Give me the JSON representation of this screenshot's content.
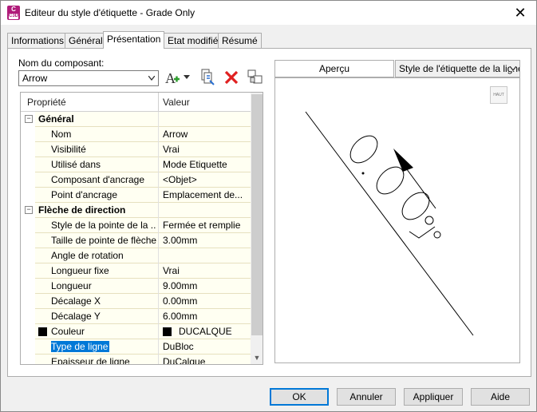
{
  "window": {
    "title": "Editeur du style d'étiquette - Grade Only",
    "icon_text": "C",
    "icon_sub": "C3D"
  },
  "tabs": [
    {
      "label": "Informations"
    },
    {
      "label": "Général"
    },
    {
      "label": "Présentation"
    },
    {
      "label": "Etat modifié"
    },
    {
      "label": "Résumé"
    }
  ],
  "active_tab": "Présentation",
  "component": {
    "label": "Nom du composant:",
    "value": "Arrow"
  },
  "grid": {
    "col_property": "Propriété",
    "col_value": "Valeur",
    "rows": [
      {
        "type": "category",
        "prop": "Général",
        "expander": "−"
      },
      {
        "prop": "Nom",
        "val": "Arrow"
      },
      {
        "prop": "Visibilité",
        "val": "Vrai"
      },
      {
        "prop": "Utilisé dans",
        "val": "Mode Etiquette"
      },
      {
        "prop": "Composant d'ancrage",
        "val": "<Objet>"
      },
      {
        "prop": "Point d'ancrage",
        "val": "Emplacement de..."
      },
      {
        "type": "category",
        "prop": "Flèche de direction",
        "expander": "−"
      },
      {
        "prop": "Style de la pointe de la ...",
        "val": "Fermée et remplie"
      },
      {
        "prop": "Taille de pointe de flèche",
        "val": "3.00mm"
      },
      {
        "prop": "Angle de rotation",
        "val": ""
      },
      {
        "prop": "Longueur fixe",
        "val": "Vrai"
      },
      {
        "prop": "Longueur",
        "val": "9.00mm"
      },
      {
        "prop": "Décalage X",
        "val": "0.00mm"
      },
      {
        "prop": "Décalage Y",
        "val": "6.00mm"
      },
      {
        "prop": "Couleur",
        "val": "DUCALQUE",
        "swatch": "#000000"
      },
      {
        "prop": "Type de ligne",
        "val": "DuBloc",
        "selected": true
      },
      {
        "prop": "Epaisseur de ligne",
        "val": "DuCalque"
      }
    ]
  },
  "preview": {
    "header": "Aperçu",
    "style_select": "Style de l'étiquette de la ligne",
    "view_button": "HAUT"
  },
  "buttons": {
    "ok": "OK",
    "cancel": "Annuler",
    "apply": "Appliquer",
    "help": "Aide"
  },
  "colors": {
    "selection": "#0078d7",
    "row_bg": "#fffff2",
    "accent": "#0078d7"
  },
  "icons": {
    "add": "add-component-icon",
    "copy": "copy-component-icon",
    "delete": "delete-icon",
    "draw_order": "draw-order-icon"
  }
}
